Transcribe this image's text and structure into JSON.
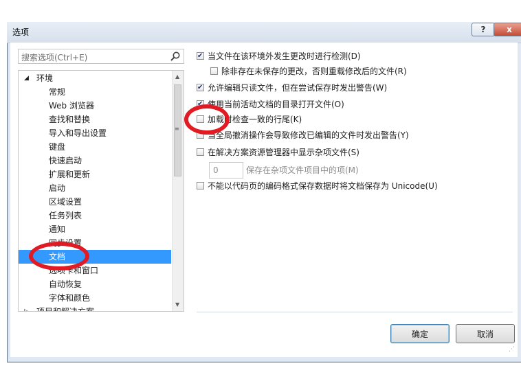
{
  "window": {
    "title": "选项",
    "help_label": "?",
    "close_label": "x"
  },
  "search": {
    "placeholder": "搜索选项(Ctrl+E)"
  },
  "tree": {
    "root": {
      "label": "环境",
      "toggle": "◢"
    },
    "items": [
      {
        "label": "常规"
      },
      {
        "label": "Web 浏览器"
      },
      {
        "label": "查找和替换"
      },
      {
        "label": "导入和导出设置"
      },
      {
        "label": "键盘"
      },
      {
        "label": "快速启动"
      },
      {
        "label": "扩展和更新"
      },
      {
        "label": "启动"
      },
      {
        "label": "区域设置"
      },
      {
        "label": "任务列表"
      },
      {
        "label": "通知"
      },
      {
        "label": "同步设置"
      },
      {
        "label": "文档",
        "selected": true
      },
      {
        "label": "选项卡和窗口"
      },
      {
        "label": "自动恢复"
      },
      {
        "label": "字体和颜色"
      }
    ],
    "next_root": {
      "label": "项目和解决方案",
      "toggle": "▷"
    }
  },
  "options": [
    {
      "label": "当文件在该环境外发生更改时进行检测(D)",
      "checked": true,
      "enabled": true
    },
    {
      "label": "除非存在未保存的更改，否则重载修改后的文件(R)",
      "checked": false,
      "enabled": true,
      "indent": true
    },
    {
      "label": "允许编辑只读文件，但在尝试保存时发出警告(W)",
      "checked": true,
      "enabled": true
    },
    {
      "label": "使用当前活动文档的目录打开文件(O)",
      "checked": true,
      "enabled": true
    },
    {
      "label": "加载时检查一致的行尾(K)",
      "checked": false,
      "enabled": true
    },
    {
      "label": "当全局撤消操作会导致修改已编辑的文件时发出警告(Y)",
      "checked": false,
      "enabled": true
    },
    {
      "label": "在解决方案资源管理器中显示杂项文件(S)",
      "checked": false,
      "enabled": true
    },
    {
      "label": "不能以代码页的编码格式保存数据时将文档保存为 Unicode(U)",
      "checked": false,
      "enabled": true
    }
  ],
  "misc_files": {
    "value": "0",
    "label": "保存在杂项文件项目中的项(M)"
  },
  "buttons": {
    "ok": "确定",
    "cancel": "取消"
  },
  "colors": {
    "selection": "#3399ff",
    "annotation": "#e01b24",
    "dialog_frame": "#dfe8f3"
  }
}
